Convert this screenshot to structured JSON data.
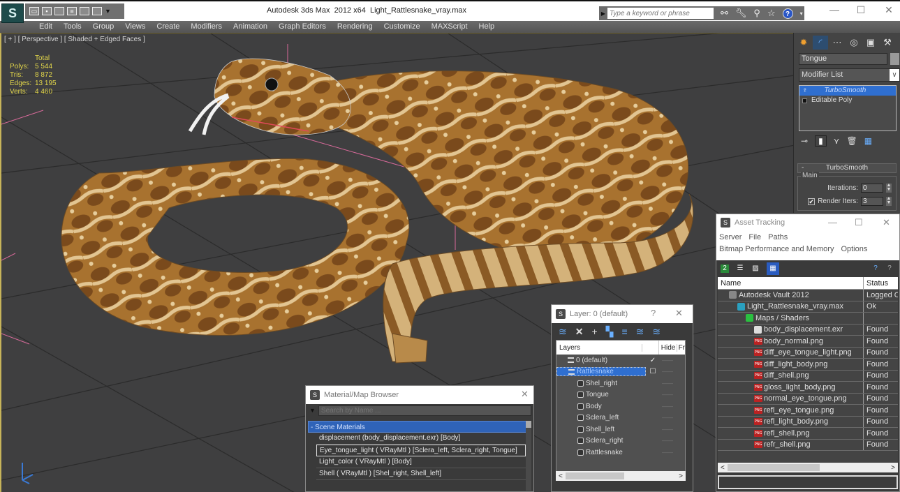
{
  "window": {
    "app_title": "Autodesk 3ds Max  2012 x64",
    "file_name": "Light_Rattlesnake_vray.max",
    "app_logo": "3ds-max-logo",
    "search_placeholder": "Type a keyword or phrase",
    "search_tools": [
      "binoculars-icon",
      "wrench-icon",
      "satellite-icon",
      "star-icon"
    ],
    "help_label": "?",
    "minimize": "—",
    "maximize": "☐",
    "close": "✕"
  },
  "quick_access": [
    "open-icon",
    "save-icon",
    "new-icon",
    "hold-icon",
    "undo-icon",
    "redo-icon",
    "dropdown-icon"
  ],
  "menu": [
    "Edit",
    "Tools",
    "Group",
    "Views",
    "Create",
    "Modifiers",
    "Animation",
    "Graph Editors",
    "Rendering",
    "Customize",
    "MAXScript",
    "Help"
  ],
  "viewport": {
    "label": "[ + ] [ Perspective ] [ Shaded + Edged Faces ]",
    "stats": {
      "header": "Total",
      "rows": [
        {
          "k": "Polys:",
          "v": "5 544"
        },
        {
          "k": "Tris:",
          "v": "8 872"
        },
        {
          "k": "Edges:",
          "v": "13 195"
        },
        {
          "k": "Verts:",
          "v": "4 460"
        }
      ]
    },
    "colors": {
      "grid": "#2c2c2c",
      "snake_light": "#d9b77a",
      "snake_dark": "#8a5a25",
      "snake_mid": "#b07c3c",
      "highlight_axis": "#d86a9a"
    }
  },
  "command_panel": {
    "tabs": [
      "create-icon",
      "modify-icon",
      "hierarchy-icon",
      "motion-icon",
      "display-icon",
      "utilities-icon"
    ],
    "object_name": "Tongue",
    "modifier_list": "Modifier List",
    "stack": [
      {
        "label": "TurboSmooth",
        "selected": true
      },
      {
        "label": "Editable Poly",
        "selected": false
      }
    ],
    "rollout": {
      "title": "TurboSmooth",
      "collapse": "-",
      "group": "Main",
      "iterations_label": "Iterations:",
      "iterations": "0",
      "render_iters_label": "Render Iters:",
      "render_iters": "3",
      "render_iters_checked": true
    }
  },
  "asset_tracking": {
    "title": "Asset Tracking",
    "menu_row1": [
      "Server",
      "File",
      "Paths"
    ],
    "menu_row2": [
      "Bitmap Performance and Memory",
      "Options"
    ],
    "columns": [
      "Name",
      "Status"
    ],
    "rows": [
      {
        "name": "Autodesk Vault 2012",
        "status": "Logged Out",
        "indent": 1,
        "icon": "vault-icon"
      },
      {
        "name": "Light_Rattlesnake_vray.max",
        "status": "Ok",
        "indent": 2,
        "icon": "max-file-icon"
      },
      {
        "name": "Maps / Shaders",
        "status": "",
        "indent": 3,
        "icon": "maps-icon"
      },
      {
        "name": "body_displacement.exr",
        "status": "Found",
        "indent": 4,
        "icon": "exr-icon"
      },
      {
        "name": "body_normal.png",
        "status": "Found",
        "indent": 4,
        "icon": "png-icon"
      },
      {
        "name": "diff_eye_tongue_light.png",
        "status": "Found",
        "indent": 4,
        "icon": "png-icon"
      },
      {
        "name": "diff_light_body.png",
        "status": "Found",
        "indent": 4,
        "icon": "png-icon"
      },
      {
        "name": "diff_shell.png",
        "status": "Found",
        "indent": 4,
        "icon": "png-icon"
      },
      {
        "name": "gloss_light_body.png",
        "status": "Found",
        "indent": 4,
        "icon": "png-icon"
      },
      {
        "name": "normal_eye_tongue.png",
        "status": "Found",
        "indent": 4,
        "icon": "png-icon"
      },
      {
        "name": "refl_eye_tongue.png",
        "status": "Found",
        "indent": 4,
        "icon": "png-icon"
      },
      {
        "name": "refl_light_body.png",
        "status": "Found",
        "indent": 4,
        "icon": "png-icon"
      },
      {
        "name": "refl_shell.png",
        "status": "Found",
        "indent": 4,
        "icon": "png-icon"
      },
      {
        "name": "refr_shell.png",
        "status": "Found",
        "indent": 4,
        "icon": "png-icon"
      }
    ],
    "png_badge": "PNG"
  },
  "layer_dialog": {
    "title": "Layer: 0 (default)",
    "help": "?",
    "columns": [
      "Layers",
      "",
      "Hide",
      "Fr"
    ],
    "rows": [
      {
        "name": "0 (default)",
        "type": "layer",
        "check": "✓",
        "indent": 1,
        "selected": false
      },
      {
        "name": "Rattlesnake",
        "type": "layer",
        "check": "☐",
        "indent": 1,
        "selected": true
      },
      {
        "name": "Shel_right",
        "type": "object",
        "check": "",
        "indent": 2,
        "selected": false
      },
      {
        "name": "Tongue",
        "type": "object",
        "check": "",
        "indent": 2,
        "selected": false
      },
      {
        "name": "Body",
        "type": "object",
        "check": "",
        "indent": 2,
        "selected": false
      },
      {
        "name": "Sclera_left",
        "type": "object",
        "check": "",
        "indent": 2,
        "selected": false
      },
      {
        "name": "Shell_left",
        "type": "object",
        "check": "",
        "indent": 2,
        "selected": false
      },
      {
        "name": "Sclera_right",
        "type": "object",
        "check": "",
        "indent": 2,
        "selected": false
      },
      {
        "name": "Rattlesnake",
        "type": "object",
        "check": "",
        "indent": 2,
        "selected": false
      }
    ],
    "hide_marker": "——"
  },
  "material_browser": {
    "title": "Material/Map Browser",
    "search_placeholder": "Search by Name ...",
    "group": "- Scene Materials",
    "items": [
      {
        "label": "displacement (body_displacement.exr) [Body]",
        "selected": false
      },
      {
        "label": "Eye_tongue_light  ( VRayMtl ) [Sclera_left, Sclera_right, Tongue]",
        "selected": true
      },
      {
        "label": "Light_color  ( VRayMtl ) [Body]",
        "selected": false
      },
      {
        "label": "Shell  ( VRayMtl ) [Shel_right, Shell_left]",
        "selected": false
      }
    ]
  },
  "scroll": {
    "left": "<",
    "right": ">"
  }
}
